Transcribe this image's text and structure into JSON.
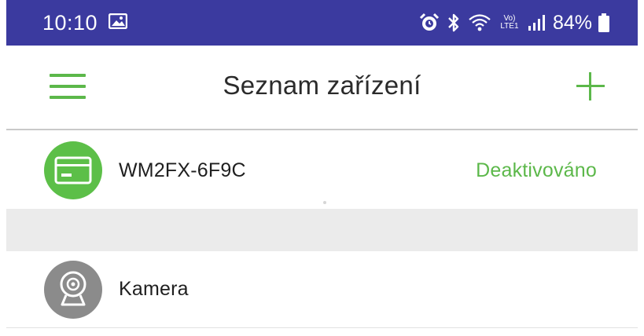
{
  "status_bar": {
    "time": "10:10",
    "battery": "84%",
    "network": "Vo) LTE1",
    "icons": [
      "image-icon",
      "alarm-icon",
      "bluetooth-icon",
      "wifi-icon",
      "signal-icon",
      "battery-icon"
    ]
  },
  "app_bar": {
    "title": "Seznam zařízení",
    "menu_icon": "hamburger-menu-icon",
    "add_icon": "plus-icon"
  },
  "devices": [
    {
      "name": "WM2FX-6F9C",
      "status": "Deaktivováno",
      "icon": "gateway-card-icon"
    },
    {
      "name": "Kamera",
      "status": "",
      "icon": "webcam-icon"
    }
  ],
  "colors": {
    "status_bar": "#3b3a9f",
    "accent": "#5cb84a",
    "avatar_green": "#5cbf48",
    "avatar_gray": "#8b8b8b",
    "separator": "#ebebeb"
  }
}
